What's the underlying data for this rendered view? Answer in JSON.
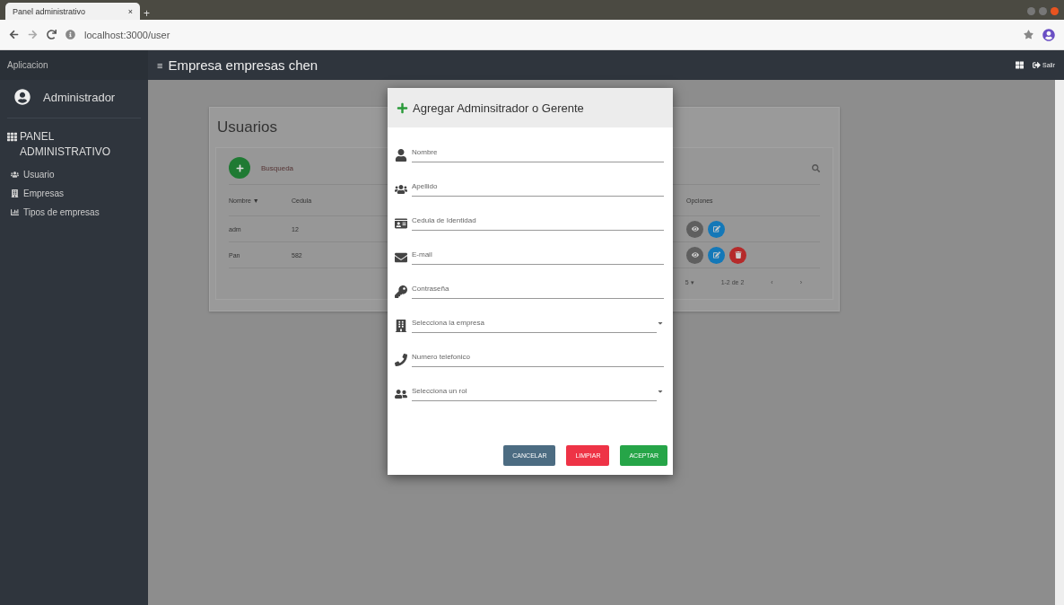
{
  "browser": {
    "tab_title": "Panel administrativo",
    "tab_close": "×",
    "new_tab": "+",
    "address": "localhost:3000/user"
  },
  "header": {
    "brand": "Aplicacion",
    "menu": "≡",
    "title": "Empresa empresas chen",
    "logout": "Salir"
  },
  "sidebar": {
    "user": "Administrador",
    "section": "PANEL ADMINISTRATIVO",
    "items": [
      {
        "label": "Usuario",
        "selected": false
      },
      {
        "label": "Empresas",
        "selected": false
      },
      {
        "label": "Tipos de empresas",
        "selected": false
      }
    ]
  },
  "card": {
    "title": "Usuarios",
    "search_placeholder": "Busqueda",
    "columns": [
      "Nombre ▼",
      "Cedula",
      "Opciones"
    ],
    "rows": [
      {
        "cells": [
          "adm",
          "12"
        ],
        "actions": [
          {
            "kind": "view"
          },
          {
            "kind": "edit"
          }
        ]
      },
      {
        "cells": [
          "Pan",
          "582"
        ],
        "actions": [
          {
            "kind": "view"
          },
          {
            "kind": "edit"
          },
          {
            "kind": "delete"
          }
        ]
      }
    ],
    "pagination": {
      "per_page": "5 ▾",
      "range": "1-2 de 2",
      "prev": "‹",
      "next": "›"
    }
  },
  "dialog": {
    "title": "Agregar Adminsitrador o Gerente",
    "fields": [
      {
        "kind": "text",
        "placeholder": "Nombre"
      },
      {
        "kind": "text",
        "placeholder": "Apellido"
      },
      {
        "kind": "text",
        "placeholder": "Cedula de Identidad"
      },
      {
        "kind": "text",
        "placeholder": "E-mail"
      },
      {
        "kind": "text",
        "placeholder": "Contraseña"
      },
      {
        "kind": "select",
        "placeholder": "Selecciona la empresa"
      },
      {
        "kind": "text",
        "placeholder": "Numero telefonico"
      },
      {
        "kind": "select",
        "placeholder": "Selecciona un rol"
      }
    ],
    "buttons": [
      {
        "label": "CANCELAR",
        "kind": "cancel"
      },
      {
        "label": "LIMPIAR",
        "kind": "clear"
      },
      {
        "label": "ACEPTAR",
        "kind": "accept"
      }
    ]
  }
}
